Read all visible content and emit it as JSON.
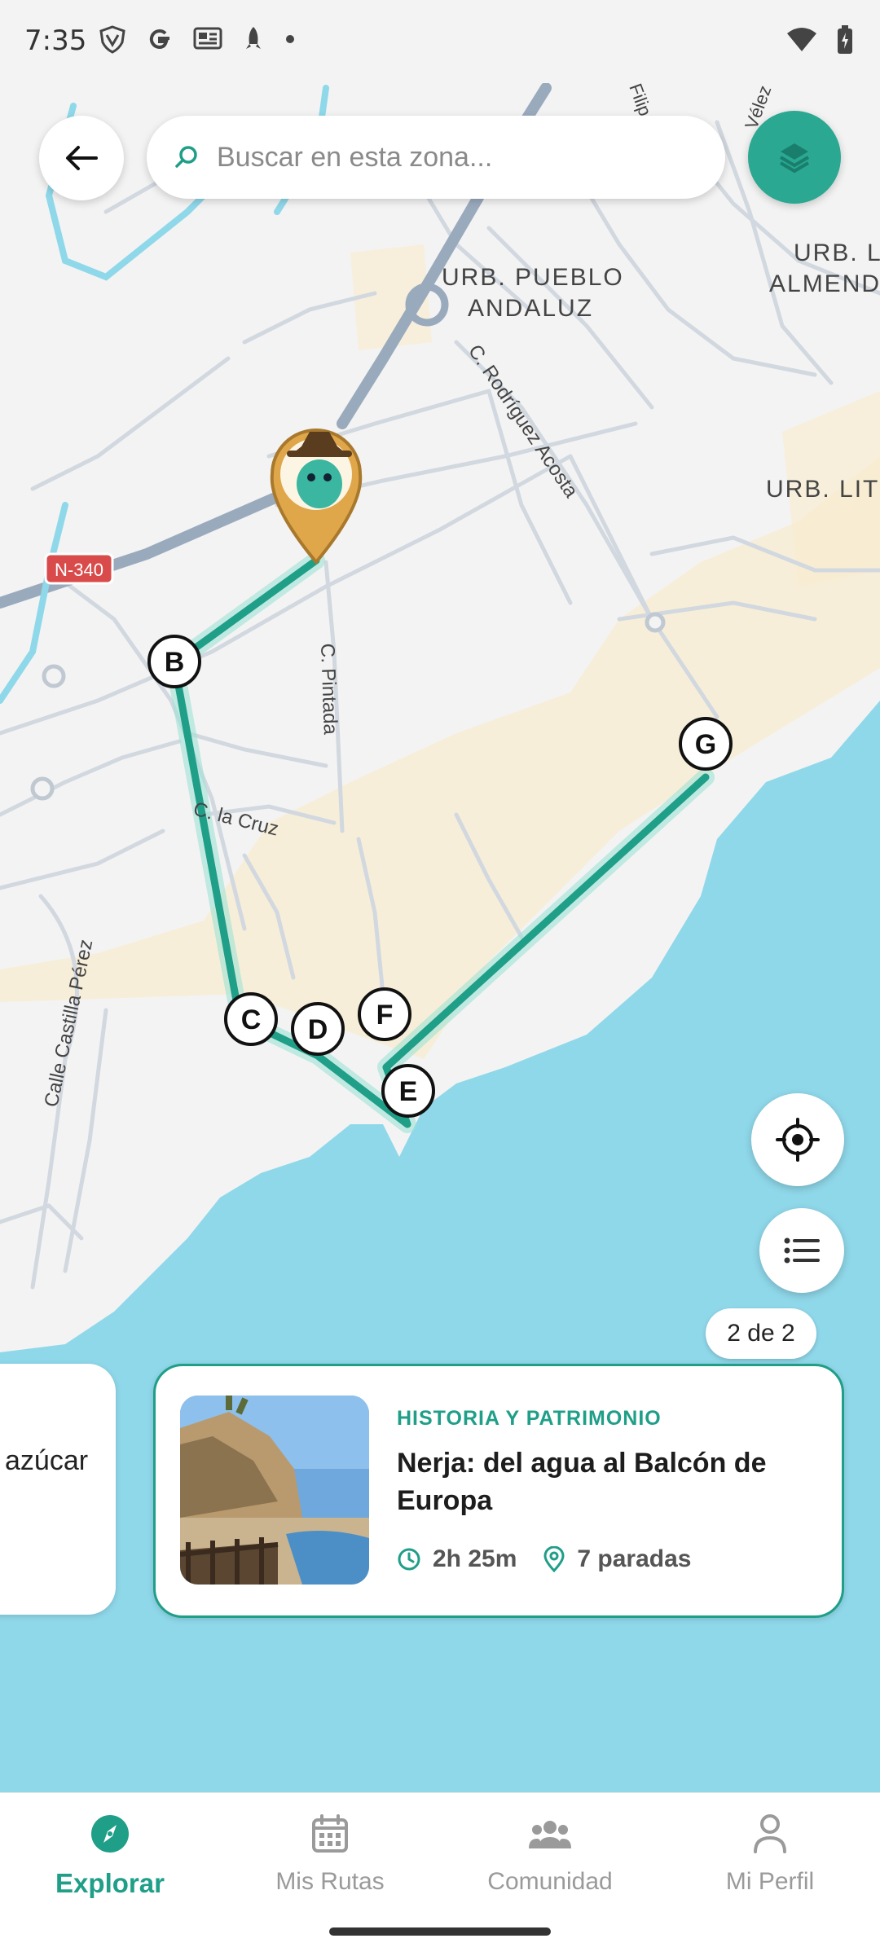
{
  "status": {
    "time": "7:35"
  },
  "search": {
    "placeholder": "Buscar en esta zona..."
  },
  "map": {
    "area_labels": [
      "URB. PUEBLO",
      "ANDALUZ",
      "URB. L",
      "ALMEND",
      "URB. LIT"
    ],
    "street_labels": [
      "C. Rodríguez Acosta",
      "C. Pintada",
      "C. la Cruz",
      "Calle Castilla Pérez",
      "Filip",
      "Vélez"
    ],
    "road_badge": "N-340",
    "stops": [
      "B",
      "C",
      "D",
      "E",
      "F",
      "G"
    ],
    "colors": {
      "water": "#8fd8ea",
      "land": "#f3f3f3",
      "sand": "#f8ecd0",
      "route": "#1f9e88",
      "accent": "#2aa891"
    }
  },
  "pager": {
    "label": "2 de 2"
  },
  "cards": {
    "previous": {
      "title_fragment": "azúcar"
    },
    "current": {
      "category": "HISTORIA Y PATRIMONIO",
      "title": "Nerja: del agua al Balcón de Europa",
      "duration": "2h 25m",
      "stops": "7 paradas"
    }
  },
  "nav": {
    "items": [
      {
        "label": "Explorar",
        "icon": "compass-icon",
        "active": true
      },
      {
        "label": "Mis Rutas",
        "icon": "calendar-icon",
        "active": false
      },
      {
        "label": "Comunidad",
        "icon": "people-icon",
        "active": false
      },
      {
        "label": "Mi Perfil",
        "icon": "person-icon",
        "active": false
      }
    ]
  }
}
